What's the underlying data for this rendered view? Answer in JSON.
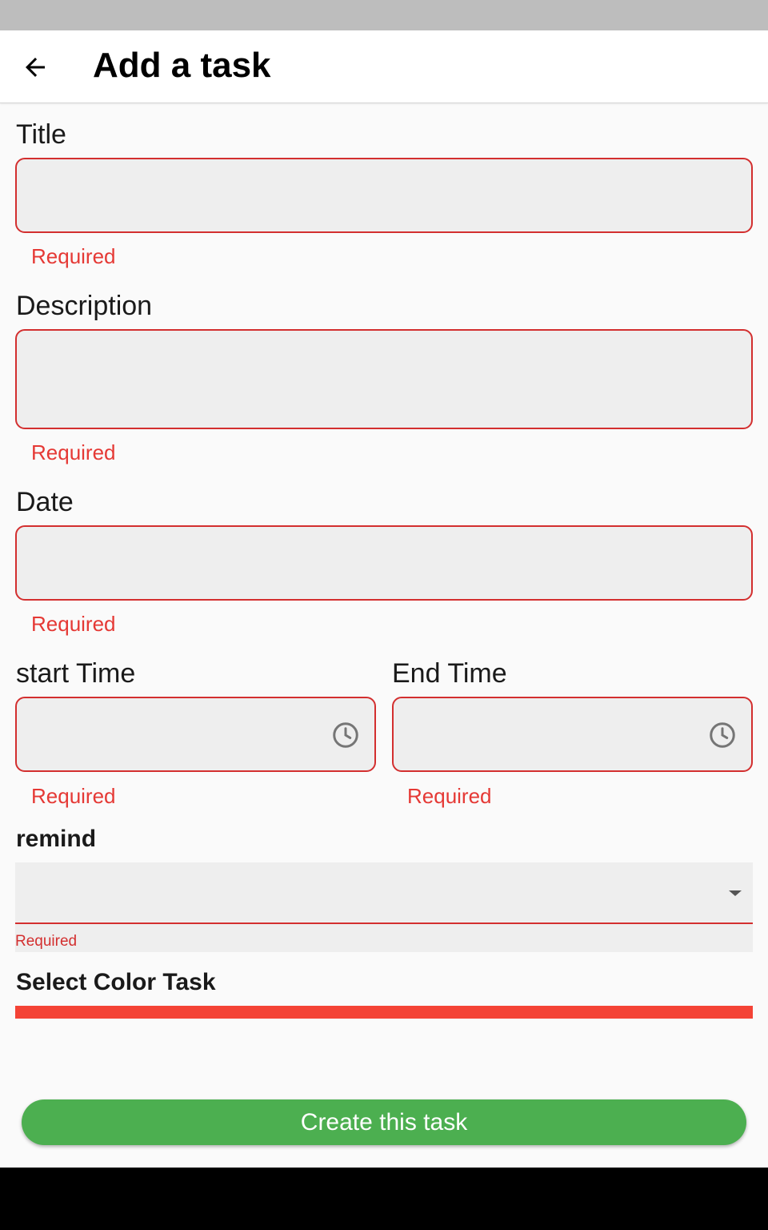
{
  "header": {
    "title": "Add a task"
  },
  "form": {
    "title_label": "Title",
    "title_value": "",
    "title_error": "Required",
    "description_label": "Description",
    "description_value": "",
    "description_error": "Required",
    "date_label": "Date",
    "date_value": "",
    "date_error": "Required",
    "start_time_label": "start Time",
    "start_time_value": "",
    "start_time_error": "Required",
    "end_time_label": "End Time",
    "end_time_value": "",
    "end_time_error": "Required",
    "remind_label": "remind",
    "remind_value": "",
    "remind_error": "Required",
    "color_label": "Select Color Task",
    "selected_color": "#f44336"
  },
  "actions": {
    "create_label": "Create this task"
  },
  "colors": {
    "error": "#d32f2f",
    "primary": "#4caf50",
    "field_bg": "#eeeeee"
  },
  "icons": {
    "back": "arrow-left-icon",
    "clock": "clock-icon",
    "dropdown": "caret-down-icon"
  }
}
